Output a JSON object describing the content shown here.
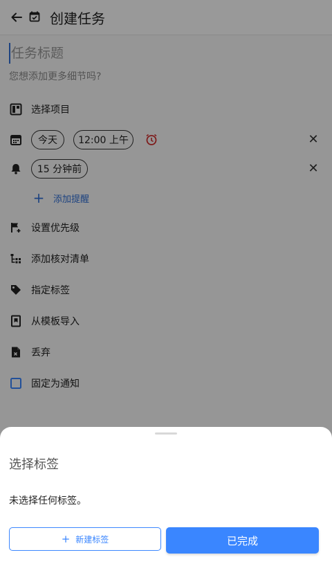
{
  "app_bar": {
    "title": "创建任务"
  },
  "task": {
    "title_placeholder": "任务标题",
    "description_placeholder": "您想添加更多细节吗?"
  },
  "rows": {
    "project": "选择项目",
    "date_chip": "今天",
    "time_chip": "12:00 上午",
    "reminder_chip": "15 分钟前",
    "add_reminder": "添加提醒",
    "priority": "设置优先级",
    "checklist": "添加核对清单",
    "tags": "指定标签",
    "template": "从模板导入",
    "discard": "丢弃",
    "pin_notification": "固定为通知",
    "clear_symbol": "✕",
    "add_symbol": "+"
  },
  "sheet": {
    "title": "选择标签",
    "empty_message": "未选择任何标签。",
    "new_tag_button": "新建标签",
    "new_tag_plus": "+",
    "done_button": "已完成"
  },
  "colors": {
    "accent": "#3a86ff",
    "link": "#2f6fd6",
    "alarm_icon": "#d32f2f",
    "scrim": "rgba(0,0,0,0.40)"
  }
}
